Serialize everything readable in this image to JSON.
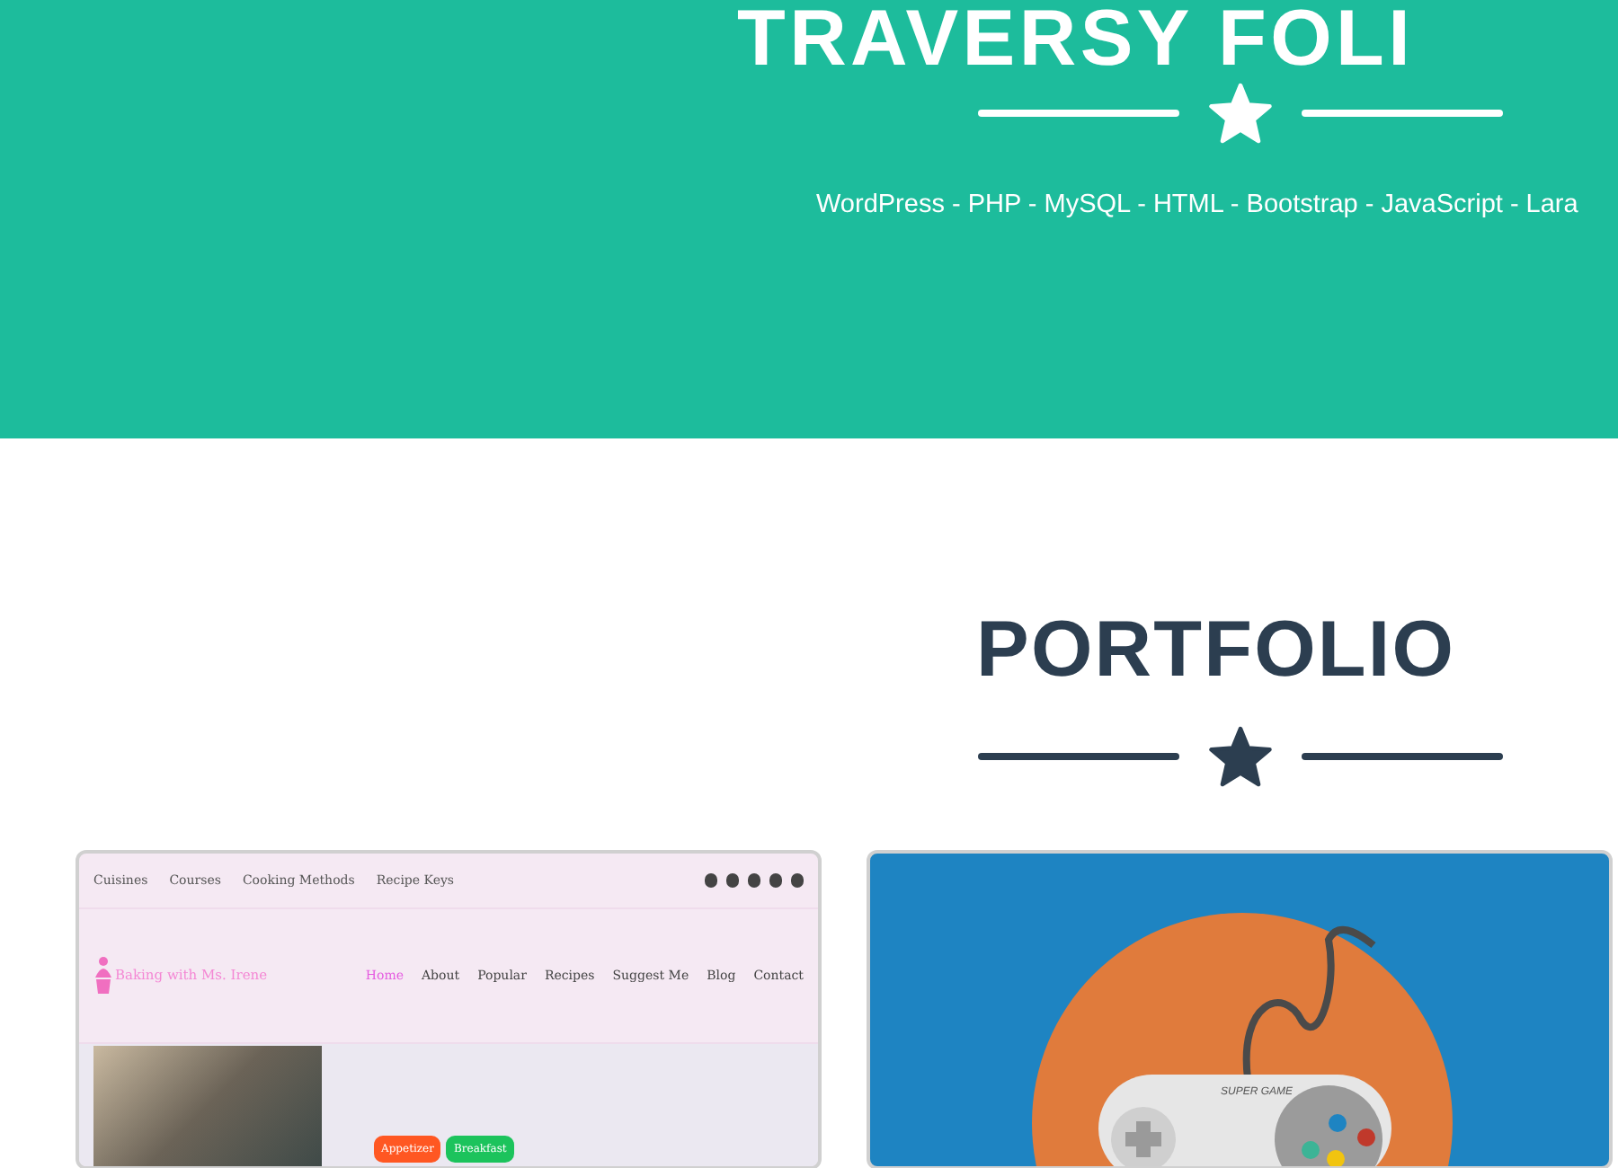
{
  "header": {
    "title": "TRAVERSY FOLI",
    "skills": "WordPress - PHP - MySQL - HTML - Bootstrap - JavaScript - Lara"
  },
  "portfolio": {
    "heading": "PORTFOLIO",
    "items": [
      {
        "kind": "website",
        "top_links": [
          "Cuisines",
          "Courses",
          "Cooking Methods",
          "Recipe Keys"
        ],
        "logo": "Baking with Ms. Irene",
        "nav": [
          {
            "label": "Home",
            "selected": true
          },
          {
            "label": "About",
            "selected": false
          },
          {
            "label": "Popular",
            "selected": false
          },
          {
            "label": "Recipes",
            "selected": false
          },
          {
            "label": "Suggest Me",
            "selected": false
          },
          {
            "label": "Blog",
            "selected": false
          },
          {
            "label": "Contact",
            "selected": false
          }
        ],
        "tags": [
          {
            "label": "Appetizer",
            "color": "#ff5722"
          },
          {
            "label": "Breakfast",
            "color": "#1cc35c"
          }
        ]
      },
      {
        "kind": "game",
        "brand": "SUPER GAME"
      }
    ]
  }
}
